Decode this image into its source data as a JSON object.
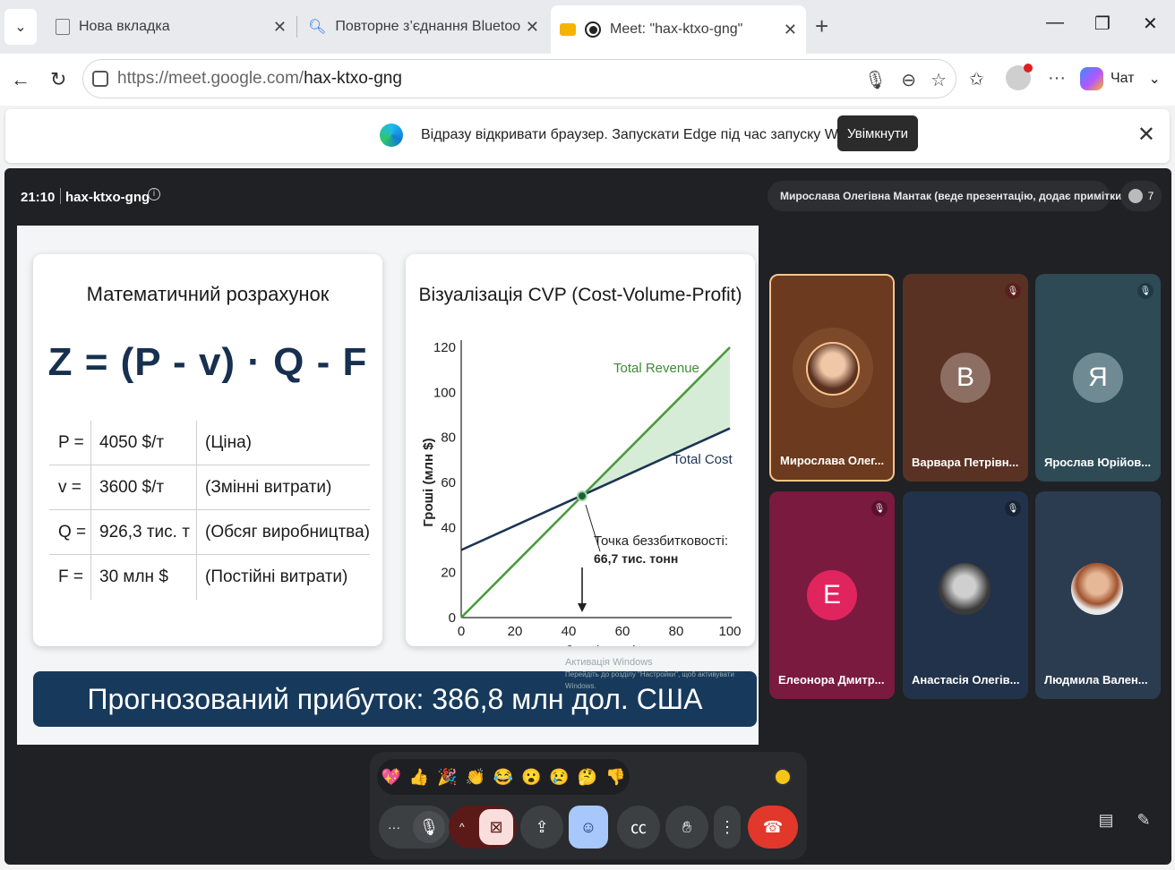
{
  "browser": {
    "tabs": [
      {
        "title": "Нова вкладка"
      },
      {
        "title": "Повторне з’єднання Bluetooth-на"
      },
      {
        "title": "Meet: \"hax-ktxo-gng\""
      }
    ],
    "url_host": "https://meet.google.com/",
    "url_path": "hax-ktxo-gng",
    "chat_label": "Чат"
  },
  "infobar": {
    "text": "Відразу відкривати браузер. Запускати Edge під час запуску Windows.",
    "button": "Увімкнути"
  },
  "meet": {
    "time": "21:10",
    "code": "hax-ktxo-gng",
    "presenter_text": "Мирослава Олегівна Мантак (веде презентацію, додає примітки)",
    "people_count": "7"
  },
  "slide": {
    "left_title": "Математичний розрахунок",
    "formula": "Z = (P - v) · Q - F",
    "variables": [
      {
        "name": "P =",
        "value": "4050 $/т",
        "desc": "(Ціна)"
      },
      {
        "name": "v =",
        "value": "3600 $/т",
        "desc": "(Змінні витрати)"
      },
      {
        "name": "Q =",
        "value": "926,3 тис. т",
        "desc": "(Обсяг виробництва)"
      },
      {
        "name": "F =",
        "value": "30 млн $",
        "desc": "(Постійні витрати)"
      }
    ],
    "banner": "Прогнозований прибуток: 386,8 млн дол. США",
    "watermark_title": "Активація Windows",
    "watermark_sub": "Перейдіть до розділу \"Настройки\", щоб активувати Windows."
  },
  "chart_data": {
    "type": "line",
    "title": "Візуалізація CVP (Cost-Volume-Profit)",
    "xlabel": "Обсяг (тис. т)",
    "ylabel": "Гроші (млн $)",
    "xlim": [
      0,
      100
    ],
    "ylim": [
      0,
      120
    ],
    "xticks": [
      0,
      20,
      40,
      60,
      80,
      100
    ],
    "yticks": [
      0,
      20,
      40,
      60,
      80,
      100,
      120
    ],
    "series": [
      {
        "name": "Total Revenue",
        "x": [
          0,
          100
        ],
        "y": [
          0,
          120
        ],
        "color": "#4a9a3e"
      },
      {
        "name": "Total Cost",
        "x": [
          0,
          100
        ],
        "y": [
          30,
          84
        ],
        "color": "#1b3552"
      }
    ],
    "annotation": {
      "line1": "Точка беззбитковості:",
      "line2": "66,7 тис. тонн",
      "x": 45,
      "y": 54
    }
  },
  "participants": [
    {
      "name": "Мирослава Олег...",
      "initial": "",
      "muted": false
    },
    {
      "name": "Варвара Петрівн...",
      "initial": "В",
      "muted": true
    },
    {
      "name": "Ярослав Юрійов...",
      "initial": "Я",
      "muted": true
    },
    {
      "name": "Елеонора Дмитр...",
      "initial": "Е",
      "muted": true
    },
    {
      "name": "Анастасія Олегів...",
      "initial": "",
      "muted": true
    },
    {
      "name": "Людмила Вален...",
      "initial": "",
      "muted": false
    }
  ],
  "reactions": [
    "💖",
    "👍",
    "🎉",
    "👏",
    "😂",
    "😮",
    "😢",
    "🤔",
    "👎"
  ],
  "colors": {
    "end_call": "#e2372b",
    "camera_off": "#f9dedc",
    "emoji_active": "#a8c7fa"
  }
}
